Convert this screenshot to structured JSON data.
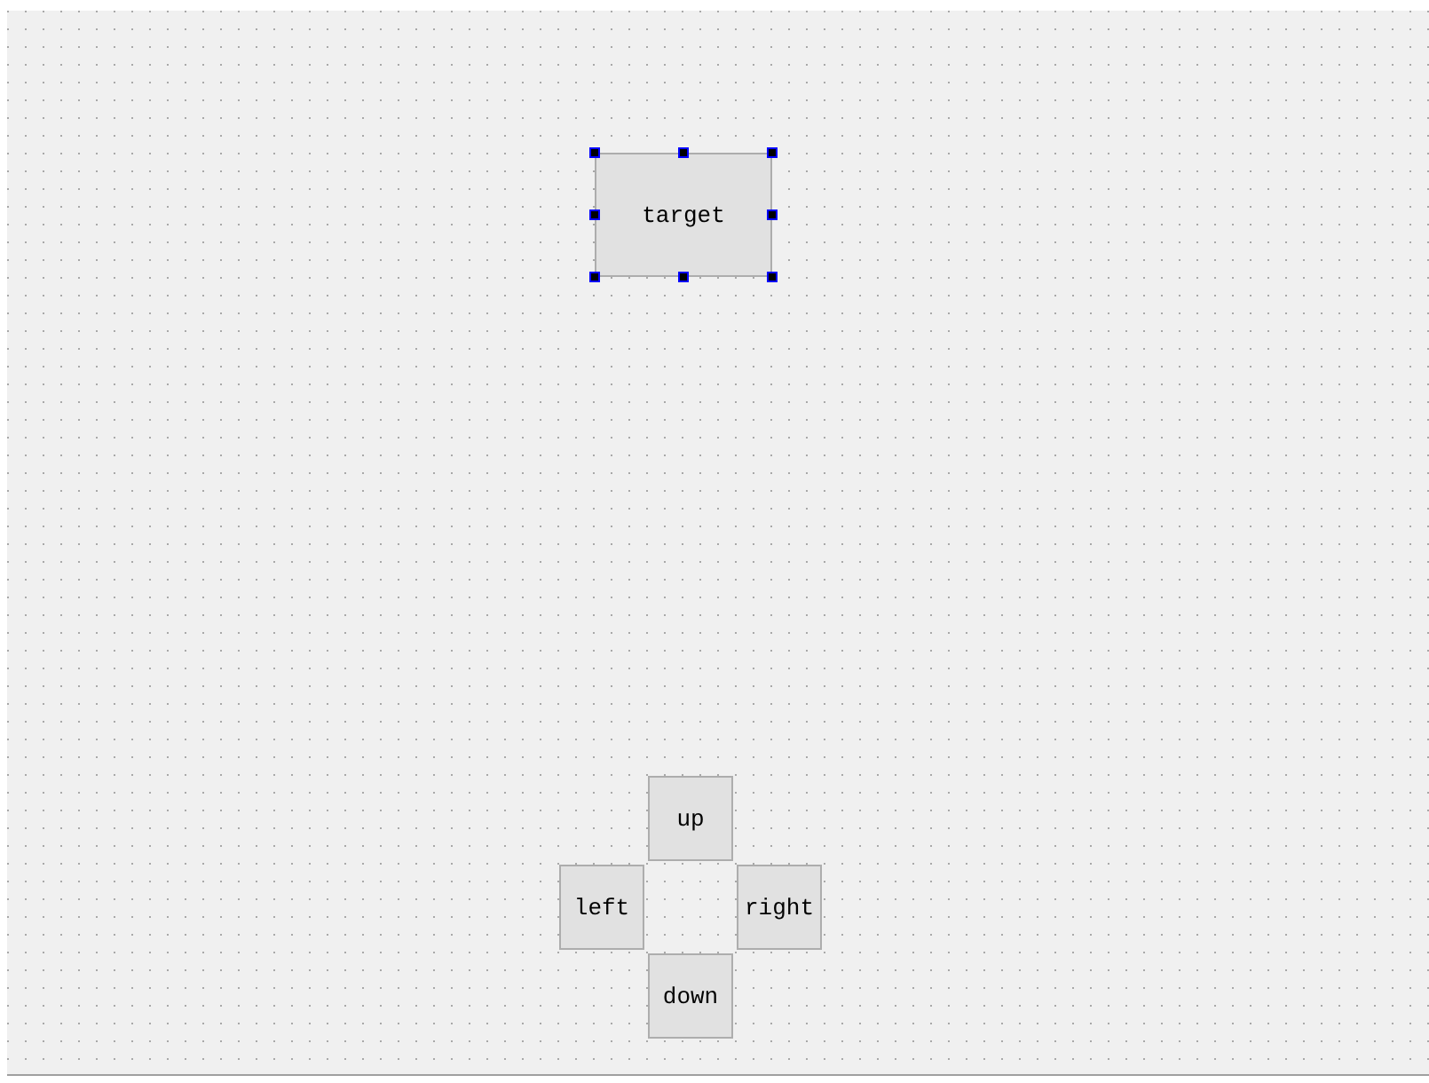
{
  "form": {
    "widgets": [
      {
        "label": "target",
        "selected": true
      }
    ],
    "direction_buttons": [
      {
        "label": "up",
        "selected": false
      },
      {
        "label": "left",
        "selected": false
      },
      {
        "label": "right",
        "selected": false
      },
      {
        "label": "down",
        "selected": false
      }
    ]
  }
}
